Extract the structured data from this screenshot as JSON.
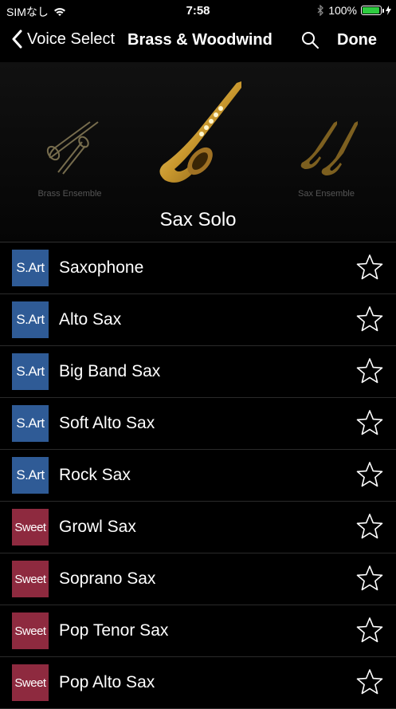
{
  "status_bar": {
    "carrier": "SIMなし",
    "time": "7:58",
    "battery": "100%",
    "wifi_icon": "wifi-icon",
    "bluetooth_icon": "bluetooth-icon"
  },
  "nav": {
    "back_label": "Voice Select",
    "title": "Brass & Woodwind",
    "done_label": "Done"
  },
  "carousel": {
    "left_caption": "Brass Ensemble",
    "right_caption": "Sax Ensemble",
    "current": "Sax Solo"
  },
  "voices": [
    {
      "badge": "S.Art",
      "name": "Saxophone"
    },
    {
      "badge": "S.Art",
      "name": "Alto Sax"
    },
    {
      "badge": "S.Art",
      "name": "Big Band Sax"
    },
    {
      "badge": "S.Art",
      "name": "Soft Alto Sax"
    },
    {
      "badge": "S.Art",
      "name": "Rock Sax"
    },
    {
      "badge": "Sweet",
      "name": "Growl Sax"
    },
    {
      "badge": "Sweet",
      "name": "Soprano Sax"
    },
    {
      "badge": "Sweet",
      "name": "Pop Tenor Sax"
    },
    {
      "badge": "Sweet",
      "name": "Pop Alto Sax"
    }
  ],
  "colors": {
    "sart_badge": "#2f5b96",
    "sweet_badge": "#8e2a3f",
    "battery_fill": "#2ecc40"
  }
}
